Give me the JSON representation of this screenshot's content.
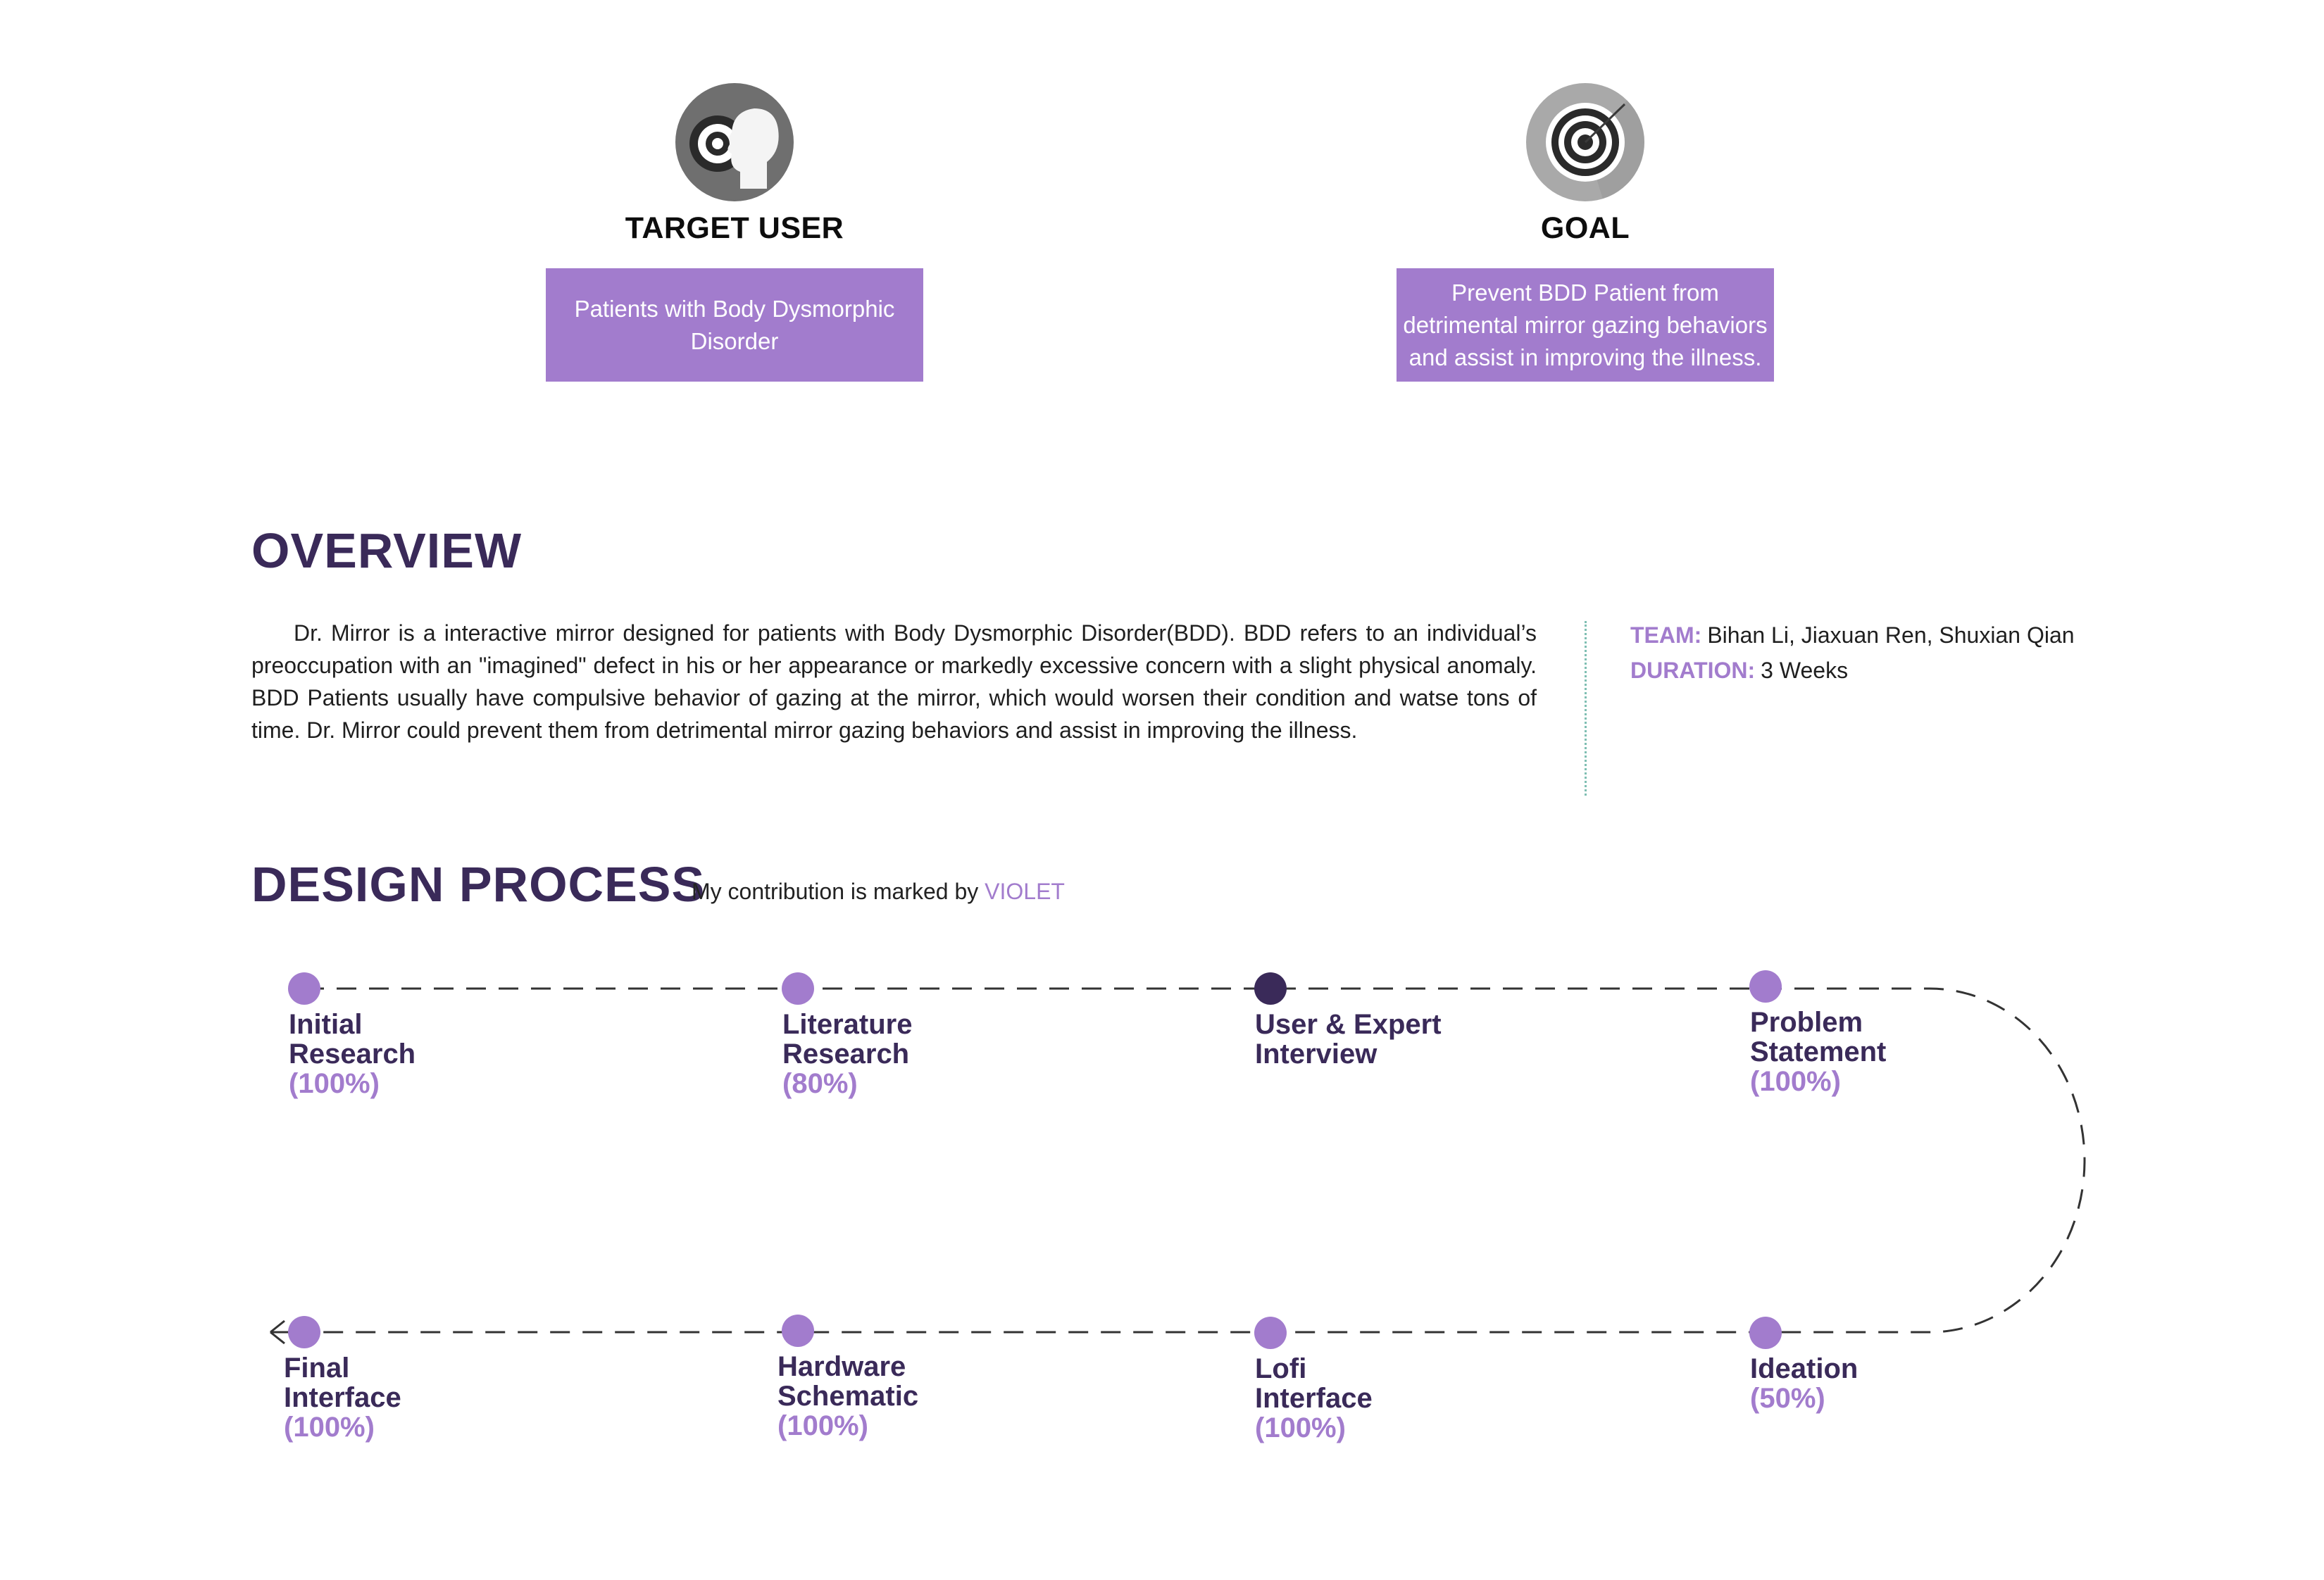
{
  "cards": {
    "target_user": {
      "title": "TARGET USER",
      "text": "Patients with Body Dysmorphic Disorder"
    },
    "goal": {
      "title": "GOAL",
      "text": "Prevent BDD Patient from detrimental mirror gazing behaviors and assist in improving the illness."
    }
  },
  "overview": {
    "heading": "OVERVIEW",
    "body": "Dr. Mirror is a interactive mirror designed for patients with Body Dysmorphic Disorder(BDD). BDD refers to an individual’s preoccupation with an \"imagined\" defect in his or her appearance or markedly excessive concern with a slight physical anomaly. BDD Patients usually have compulsive behavior of gazing at the mirror, which would worsen their condition and watse tons of time.  Dr. Mirror could prevent them from detrimental mirror gazing behaviors and assist in improving the illness.",
    "team_label": "TEAM:",
    "team_value": "Bihan Li, Jiaxuan Ren, Shuxian Qian",
    "duration_label": "DURATION:",
    "duration_value": "3 Weeks"
  },
  "process": {
    "heading": "DESIGN PROCESS",
    "subtitle_prefix": "My contribution is marked by",
    "subtitle_highlight": "VIOLET",
    "colors": {
      "violet": "#a27ccd",
      "dark": "#3a2a59"
    },
    "steps": [
      {
        "line1": "Initial",
        "line2": "Research",
        "pct": "(100%)",
        "highlight": true
      },
      {
        "line1": "Literature",
        "line2": "Research",
        "pct": "(80%)",
        "highlight": true
      },
      {
        "line1": "User & Expert",
        "line2": "Interview",
        "pct": "",
        "highlight": false
      },
      {
        "line1": "Problem",
        "line2": "Statement",
        "pct": "(100%)",
        "highlight": true
      },
      {
        "line1": "Ideation",
        "line2": "",
        "pct": "(50%)",
        "highlight": true
      },
      {
        "line1": "Lofi",
        "line2": "Interface",
        "pct": "(100%)",
        "highlight": true
      },
      {
        "line1": "Hardware",
        "line2": "Schematic",
        "pct": "(100%)",
        "highlight": true
      },
      {
        "line1": "Final",
        "line2": "Interface",
        "pct": "(100%)",
        "highlight": true
      }
    ]
  }
}
